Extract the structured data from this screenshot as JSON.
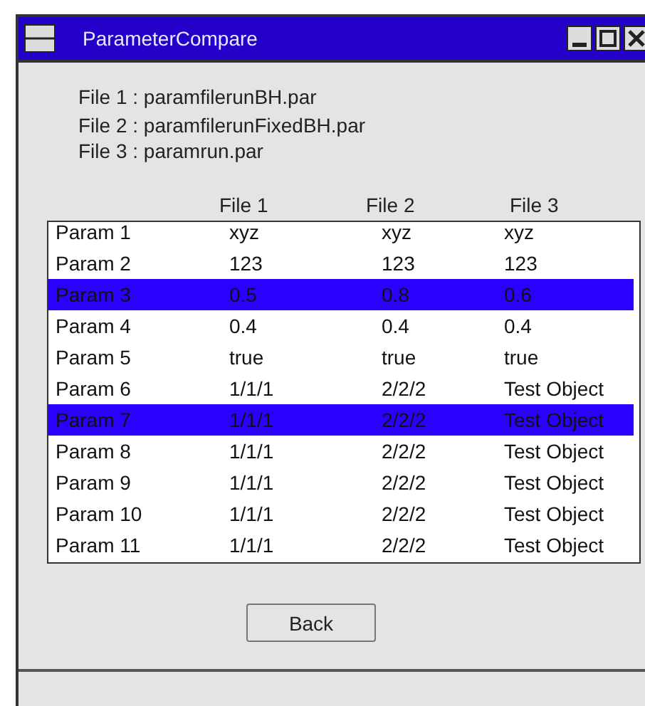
{
  "window": {
    "title": "ParameterCompare"
  },
  "files": [
    "File 1 : paramfilerunBH.par",
    "File 2 : paramfilerunFixedBH.par",
    "File 3 : paramrun.par"
  ],
  "table": {
    "columns": [
      "File 1",
      "File 2",
      "File 3"
    ],
    "rows": [
      {
        "name": "Param 1",
        "values": [
          "xyz",
          "xyz",
          "xyz"
        ],
        "selected": false
      },
      {
        "name": "Param 2",
        "values": [
          "123",
          "123",
          "123"
        ],
        "selected": false
      },
      {
        "name": "Param 3",
        "values": [
          "0.5",
          "0.8",
          "0.6"
        ],
        "selected": true
      },
      {
        "name": "Param 4",
        "values": [
          "0.4",
          "0.4",
          "0.4"
        ],
        "selected": false
      },
      {
        "name": "Param 5",
        "values": [
          "true",
          "true",
          "true"
        ],
        "selected": false
      },
      {
        "name": "Param 6",
        "values": [
          "1/1/1",
          "2/2/2",
          "Test Object"
        ],
        "selected": false
      },
      {
        "name": "Param 7",
        "values": [
          "1/1/1",
          "2/2/2",
          "Test Object"
        ],
        "selected": true
      },
      {
        "name": "Param 8",
        "values": [
          "1/1/1",
          "2/2/2",
          "Test Object"
        ],
        "selected": false
      },
      {
        "name": "Param 9",
        "values": [
          "1/1/1",
          "2/2/2",
          "Test Object"
        ],
        "selected": false
      },
      {
        "name": "Param 10",
        "values": [
          "1/1/1",
          "2/2/2",
          "Test Object"
        ],
        "selected": false
      },
      {
        "name": "Param 11",
        "values": [
          "1/1/1",
          "2/2/2",
          "Test Object"
        ],
        "selected": false
      }
    ]
  },
  "buttons": [
    "Back"
  ]
}
